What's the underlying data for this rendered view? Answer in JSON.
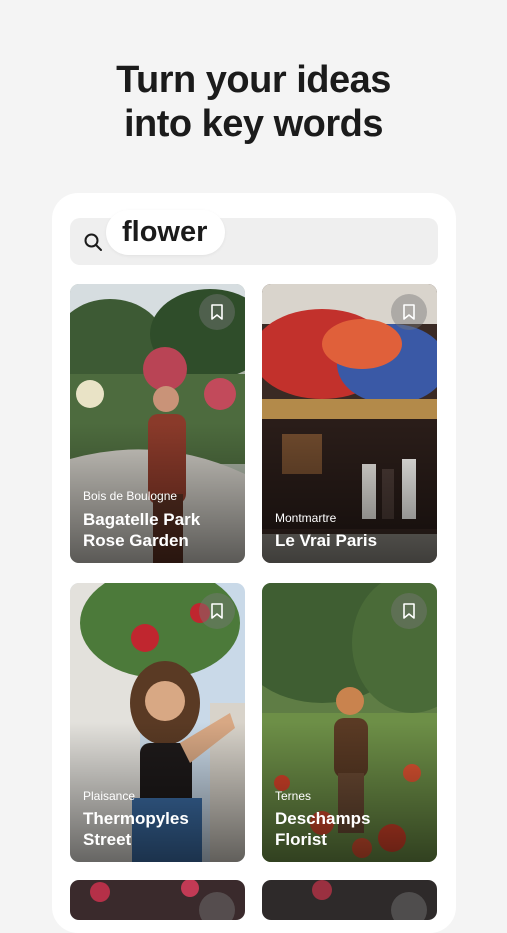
{
  "headline": {
    "line1": "Turn your ideas",
    "line2": "into key words"
  },
  "search": {
    "query": "flower"
  },
  "cards": [
    {
      "area": "Bois de Boulogne",
      "title_lines": [
        "Bagatelle Park",
        "Rose Garden"
      ]
    },
    {
      "area": "Montmartre",
      "title_lines": [
        "Le Vrai Paris"
      ]
    },
    {
      "area": "Plaisance",
      "title_lines": [
        "Thermopyles",
        "Street"
      ]
    },
    {
      "area": "Ternes",
      "title_lines": [
        "Deschamps",
        "Florist"
      ]
    }
  ],
  "icons": {
    "search": "search-icon",
    "bookmark": "bookmark-icon"
  },
  "colors": {
    "background": "#f4f4f4",
    "panel": "#ffffff",
    "search_bar": "#efefef",
    "text": "#1b1b1b"
  }
}
